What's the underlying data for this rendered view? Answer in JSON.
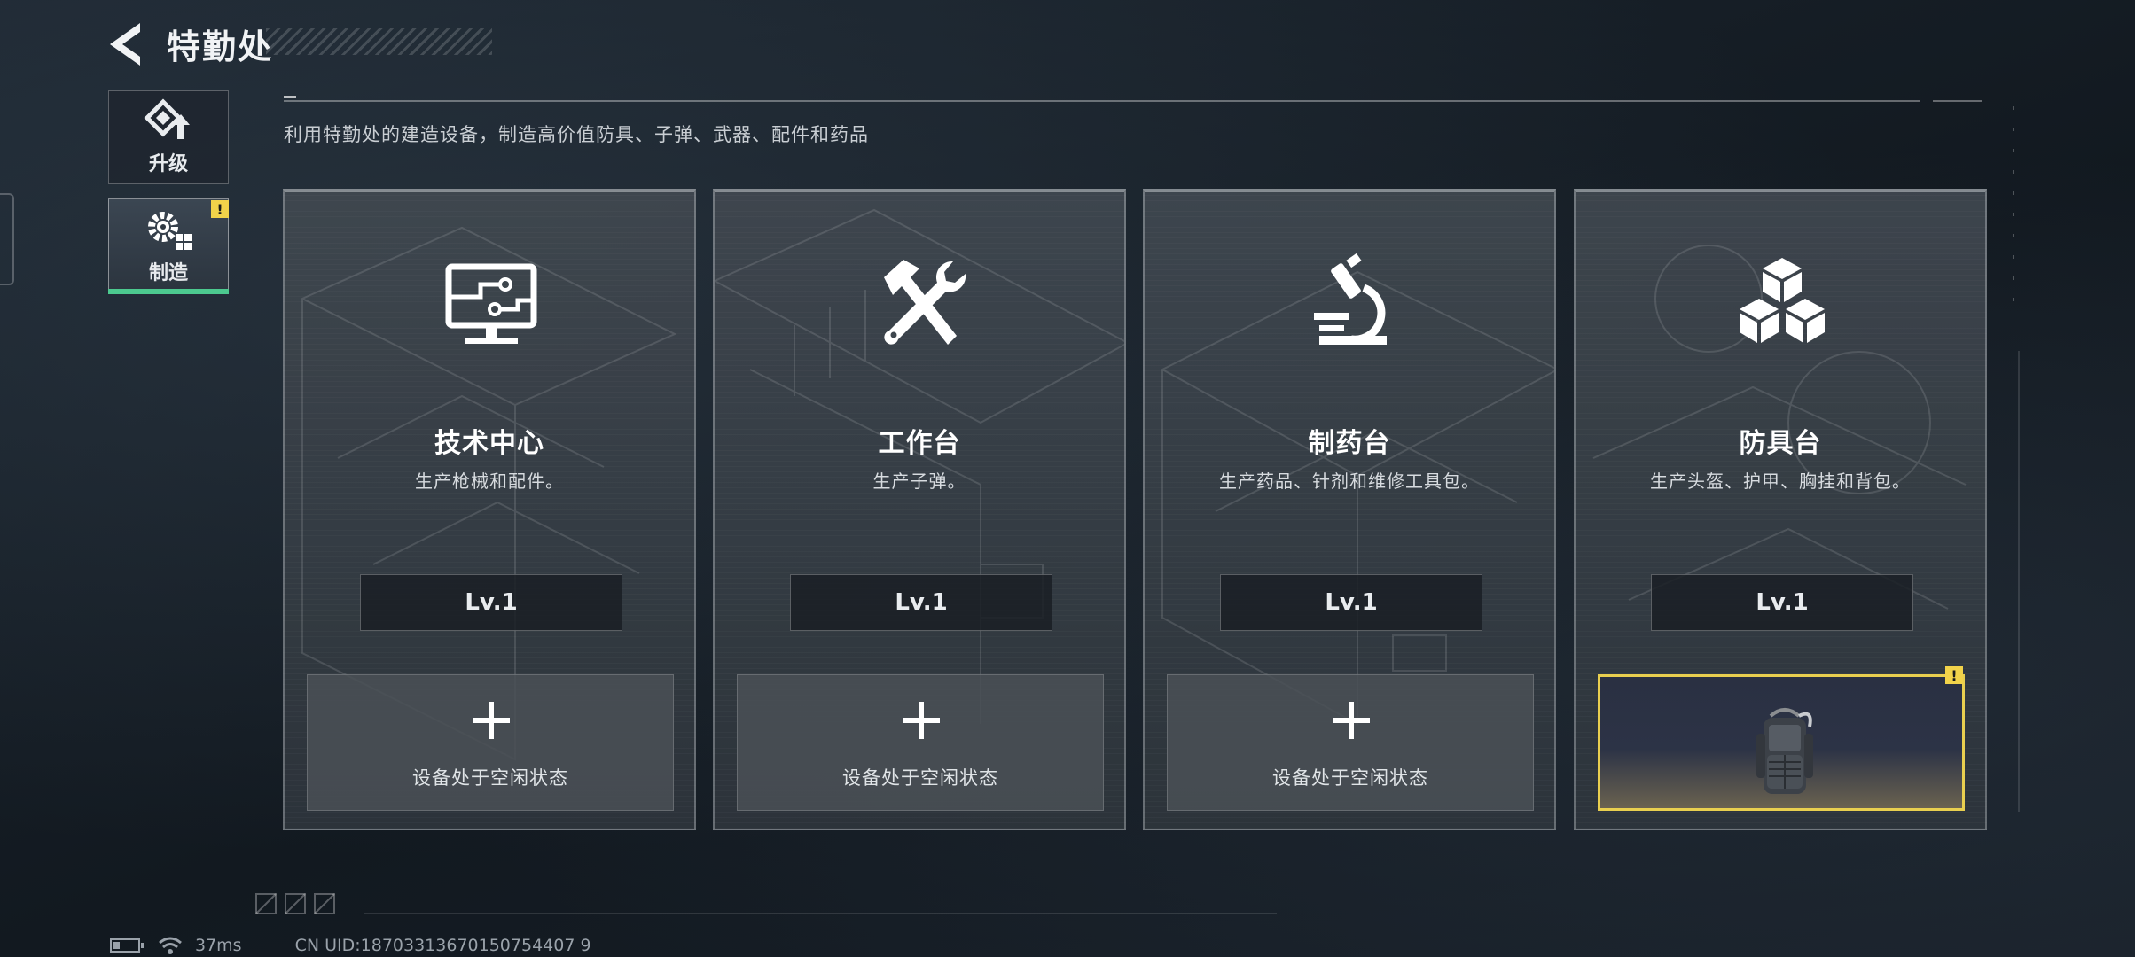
{
  "header": {
    "title": "特勤处"
  },
  "side_tabs": [
    {
      "label": "升级",
      "icon": "upgrade-arrow-icon"
    },
    {
      "label": "制造",
      "icon": "gears-icon",
      "selected": true,
      "warning": "!"
    }
  ],
  "description": "利用特勤处的建造设备，制造高价值防具、子弹、武器、配件和药品",
  "cards": [
    {
      "title": "技术中心",
      "desc": "生产枪械和配件。",
      "level": "Lv.1",
      "icon": "computer-monitor-icon",
      "slot": {
        "label": "设备处于空闲状态",
        "state": "idle"
      }
    },
    {
      "title": "工作台",
      "desc": "生产子弹。",
      "level": "Lv.1",
      "icon": "hammer-wrench-icon",
      "slot": {
        "label": "设备处于空闲状态",
        "state": "idle"
      }
    },
    {
      "title": "制药台",
      "desc": "生产药品、针剂和维修工具包。",
      "level": "Lv.1",
      "icon": "microscope-icon",
      "slot": {
        "label": "设备处于空闲状态",
        "state": "idle"
      }
    },
    {
      "title": "防具台",
      "desc": "生产头盔、护甲、胸挂和背包。",
      "level": "Lv.1",
      "icon": "cubes-icon",
      "slot": {
        "state": "producing",
        "item": "backpack-icon",
        "warning": "!"
      }
    }
  ],
  "status_bar": {
    "ping": "37ms",
    "uid": "CN UID:18703313670150754407 9"
  },
  "colors": {
    "accent_green": "#4cc98f",
    "warning_yellow": "#f2d34a",
    "active_slot_border": "#e9cf4f"
  }
}
